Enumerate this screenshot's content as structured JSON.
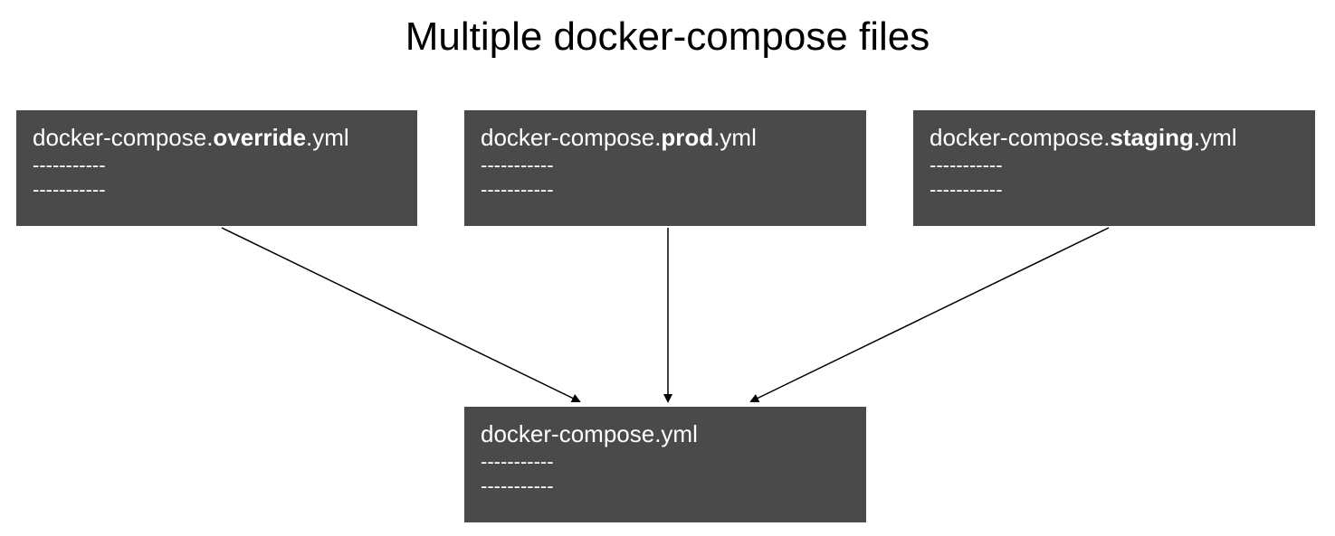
{
  "title": "Multiple docker-compose files",
  "boxes": {
    "override": {
      "prefix": "docker-compose.",
      "bold": "override",
      "suffix": ".yml",
      "dash1": "-----------",
      "dash2": "-----------"
    },
    "prod": {
      "prefix": "docker-compose.",
      "bold": "prod",
      "suffix": ".yml",
      "dash1": "-----------",
      "dash2": "-----------"
    },
    "staging": {
      "prefix": "docker-compose.",
      "bold": "staging",
      "suffix": ".yml",
      "dash1": "-----------",
      "dash2": "-----------"
    },
    "base": {
      "label": "docker-compose.yml",
      "dash1": "-----------",
      "dash2": "-----------"
    }
  }
}
